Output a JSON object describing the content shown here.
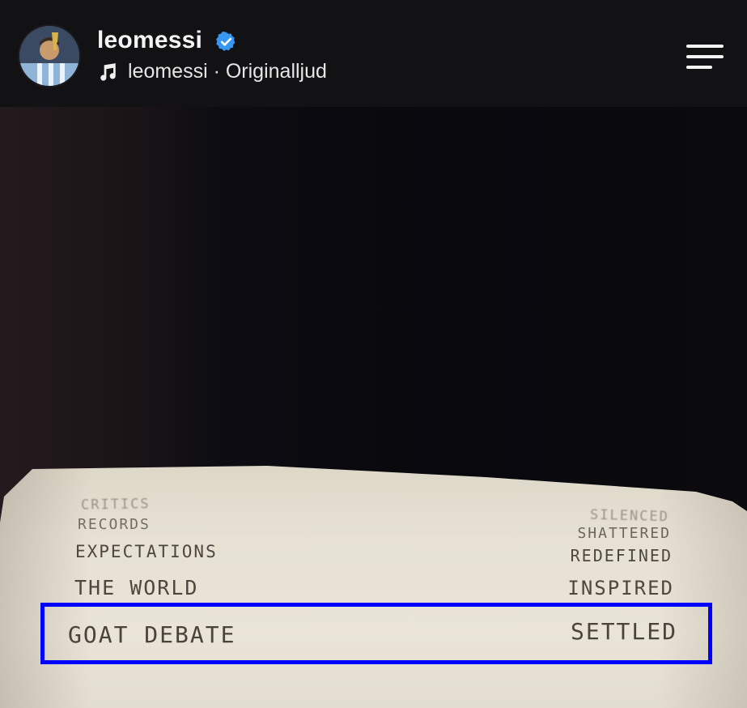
{
  "header": {
    "username": "leomessi",
    "verified_icon": "verified-badge-icon",
    "audio_icon": "music-note-icon",
    "audio_text": "leomessi · Originalljud",
    "menu_icon": "hamburger-menu-icon"
  },
  "receipt": {
    "lines": [
      {
        "left": "CRITICS",
        "right": "SILENCED"
      },
      {
        "left": "RECORDS",
        "right": "SHATTERED"
      },
      {
        "left": "EXPECTATIONS",
        "right": "REDEFINED"
      },
      {
        "left": "THE WORLD",
        "right": "INSPIRED"
      },
      {
        "left": "GOAT DEBATE",
        "right": "SETTLED"
      }
    ]
  },
  "colors": {
    "highlight_border": "#0000ff",
    "verified_blue": "#3797f0"
  }
}
